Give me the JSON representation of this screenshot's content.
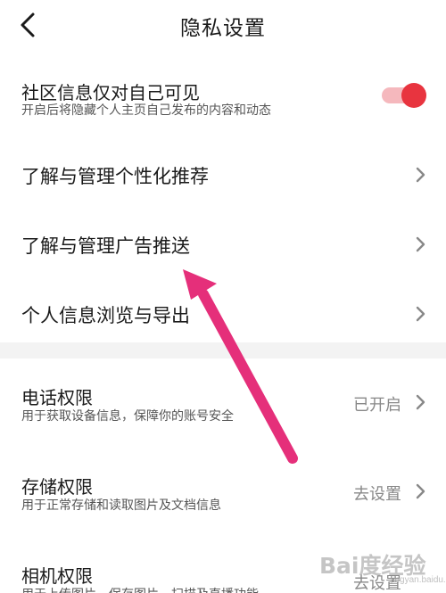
{
  "header": {
    "title": "隐私设置",
    "back_icon": "chevron-left-icon"
  },
  "community_visibility": {
    "title": "社区信息仅对自己可见",
    "subtitle": "开启后将隐藏个人主页自己发布的内容和动态",
    "toggle_on": true,
    "toggle_color": "#e8343f"
  },
  "links": [
    {
      "label": "了解与管理个性化推荐"
    },
    {
      "label": "了解与管理广告推送"
    },
    {
      "label": "个人信息浏览与导出"
    }
  ],
  "permissions": [
    {
      "title": "电话权限",
      "subtitle": "用于获取设备信息，保障你的账号安全",
      "status": "已开启"
    },
    {
      "title": "存储权限",
      "subtitle": "用于正常存储和读取图片及文档信息",
      "status": "去设置"
    },
    {
      "title": "相机权限",
      "subtitle": "用于上传图片、保存图片、扫描及直播功能",
      "status": "去设置"
    }
  ],
  "annotation": {
    "arrow_color": "#e52f7a"
  },
  "watermark": {
    "text": "Bai度经验",
    "sub": "jingyan.baidu.com"
  }
}
